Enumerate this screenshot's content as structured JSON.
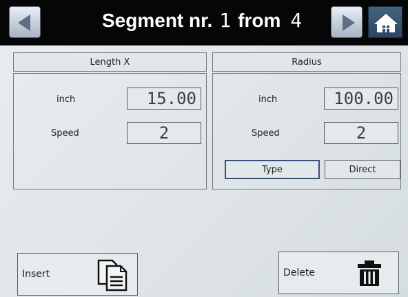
{
  "header": {
    "title_prefix": "Segment nr.",
    "segment_current": "1",
    "title_mid": "from",
    "segment_total": "4",
    "prev_icon": "arrow-left-icon",
    "next_icon": "arrow-right-icon",
    "home_icon": "home-icon"
  },
  "left_panel": {
    "title": "Length X",
    "unit_label": "inch",
    "unit_value": "15.00",
    "speed_label": "Speed",
    "speed_value": "2"
  },
  "right_panel": {
    "title": "Radius",
    "unit_label": "inch",
    "unit_value": "100.00",
    "speed_label": "Speed",
    "speed_value": "2",
    "type_button": "Type",
    "direct_button": "Direct"
  },
  "footer": {
    "insert_label": "Insert",
    "insert_icon": "document-icon",
    "delete_label": "Delete",
    "delete_icon": "trash-icon"
  },
  "colors": {
    "header_bg": "#060606",
    "screen_bg": "#e2e8eb",
    "home_button": "#35506b",
    "active_border": "#3d4e7d"
  }
}
